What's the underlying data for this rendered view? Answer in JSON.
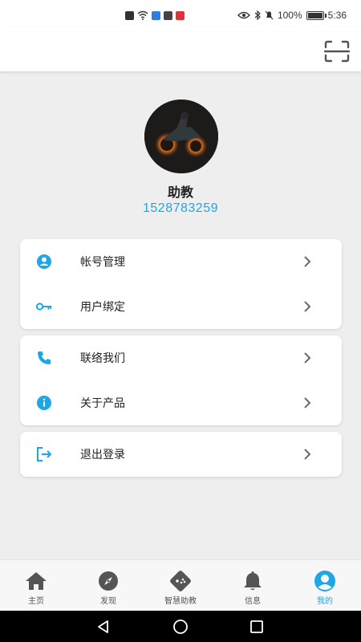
{
  "status_bar": {
    "battery_text": "100%",
    "time": "5:36",
    "battery_level": 1.0
  },
  "profile": {
    "name": "助教",
    "phone": "1528783259"
  },
  "menu": {
    "group1": [
      {
        "label": "帐号管理",
        "icon": "account-circle-icon"
      },
      {
        "label": "用户绑定",
        "icon": "key-icon"
      }
    ],
    "group2": [
      {
        "label": "联络我们",
        "icon": "phone-icon"
      },
      {
        "label": "关于产品",
        "icon": "info-icon"
      }
    ],
    "group3": [
      {
        "label": "退出登录",
        "icon": "logout-icon"
      }
    ]
  },
  "bottom_nav": [
    {
      "label": "主页",
      "icon": "home-icon"
    },
    {
      "label": "发现",
      "icon": "compass-icon"
    },
    {
      "label": "智慧助教",
      "icon": "gamepad-icon"
    },
    {
      "label": "信息",
      "icon": "bell-icon"
    },
    {
      "label": "我的",
      "icon": "user-circle-icon",
      "active": true
    }
  ],
  "colors": {
    "accent": "#1ea7e4",
    "background": "#eeeeee",
    "card": "#ffffff",
    "icon_gray": "#555555"
  }
}
